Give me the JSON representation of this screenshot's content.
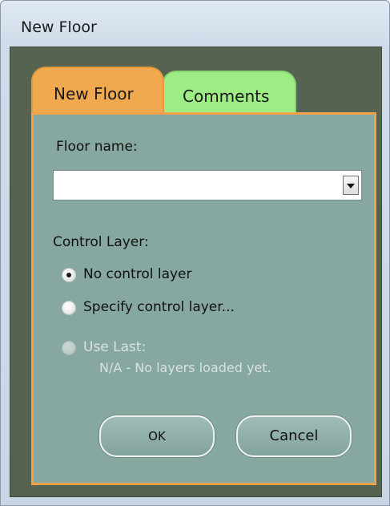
{
  "window": {
    "title": "New Floor"
  },
  "tabs": [
    {
      "label": "New Floor",
      "active": true,
      "color": "#f0a94e"
    },
    {
      "label": "Comments",
      "active": false,
      "color": "#9dec84"
    }
  ],
  "form": {
    "floor_name_label": "Floor name:",
    "floor_name_value": "",
    "control_layer_label": "Control Layer:",
    "options": [
      {
        "label": "No control layer",
        "selected": true,
        "enabled": true
      },
      {
        "label": "Specify control layer...",
        "selected": false,
        "enabled": true
      },
      {
        "label": "Use Last:",
        "selected": false,
        "enabled": false
      }
    ],
    "use_last_note": "N/A - No layers loaded yet."
  },
  "buttons": {
    "ok": "OK",
    "cancel": "Cancel"
  },
  "colors": {
    "panel": "#87a7a1",
    "frame": "#556350",
    "tab_border": "#eea24a"
  }
}
